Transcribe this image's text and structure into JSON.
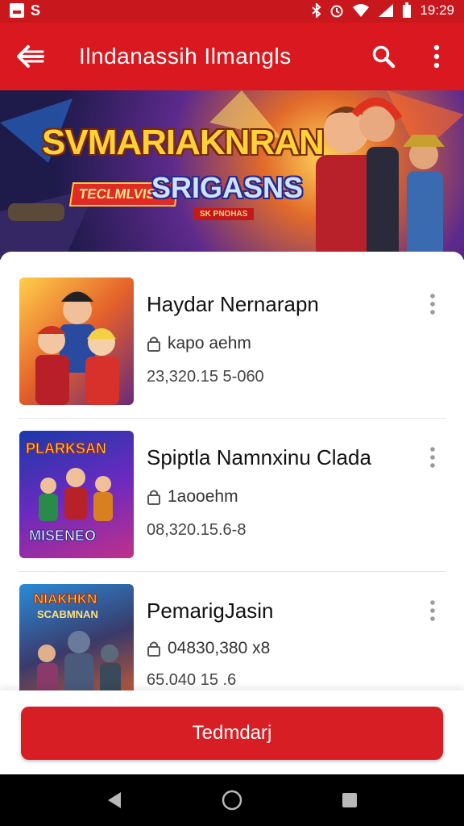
{
  "status_bar": {
    "time": "19:29",
    "left_icons": [
      "image-icon",
      "s-icon"
    ],
    "right_icons": [
      "bluetooth-icon",
      "alarm-icon",
      "wifi-icon",
      "signal-icon",
      "battery-icon"
    ],
    "s_glyph": "S"
  },
  "app_bar": {
    "title": "Ilndanassih Ilmangls",
    "color": "#d9191f"
  },
  "banner": {
    "title": "SVMARIAKNRAN",
    "subtitle_left": "TECLMLVISIN",
    "subtitle": "SRIGASNS",
    "tag": "SK PNOHAS"
  },
  "items": [
    {
      "title": "Haydar Nernarapn",
      "meta": "kapo aehm",
      "number": "23,320.15 5-060",
      "thumb_text": []
    },
    {
      "title": "Spiptla Namnxinu  Clada",
      "meta": "1aooehm",
      "number": "08,320.15.6-8",
      "thumb_text": [
        "PLARKSAN",
        "MISENEO"
      ]
    },
    {
      "title": "PemarigJasin",
      "meta": "04830,380  x8",
      "number": "65.040 15 .6",
      "thumb_text": [
        "NIAKHKN",
        "SCABMNAN"
      ]
    }
  ],
  "primary_button": {
    "label": "Tedmdarj"
  },
  "colors": {
    "accent": "#d71e24",
    "status": "#c8171d"
  }
}
